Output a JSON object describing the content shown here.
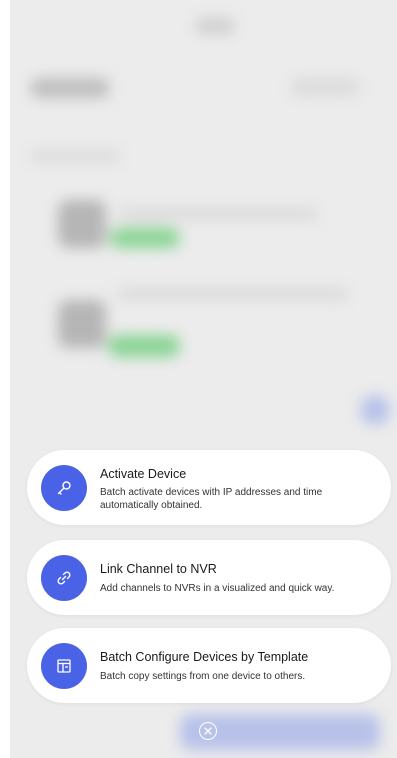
{
  "actions": [
    {
      "title": "Activate Device",
      "description": "Batch activate devices with IP addresses and time automatically obtained.",
      "icon": "key-icon"
    },
    {
      "title": "Link Channel to NVR",
      "description": "Add channels to NVRs in a visualized and quick way.",
      "icon": "link-icon"
    },
    {
      "title": "Batch Configure Devices by Template",
      "description": "Batch copy settings from one device to others.",
      "icon": "template-icon"
    }
  ],
  "close_button": {
    "icon": "close-icon"
  },
  "colors": {
    "accent": "#4a63e6",
    "card_background": "#ffffff",
    "scrim": "#ededed",
    "status_green": "#3cc24e"
  }
}
